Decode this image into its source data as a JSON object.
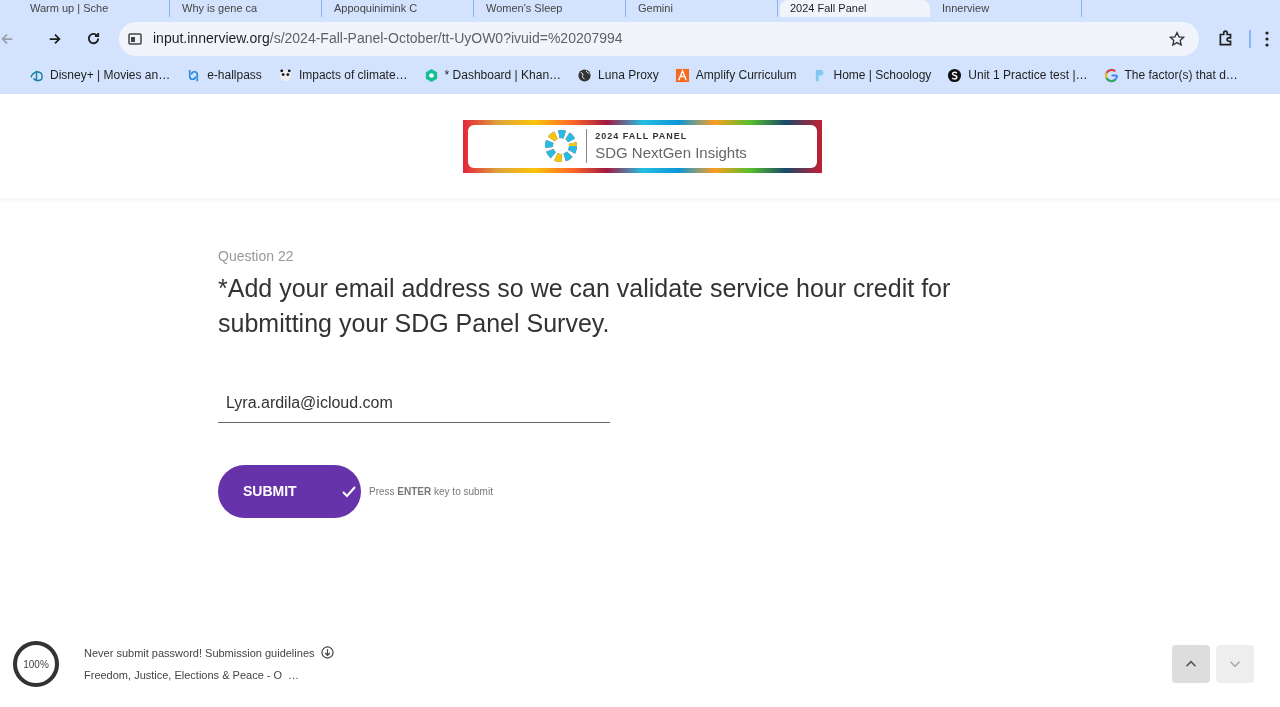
{
  "browser": {
    "tabs": [
      {
        "title": "Warm up | Sche",
        "selected": false
      },
      {
        "title": "Why is gene ca",
        "selected": false
      },
      {
        "title": "Appoquinimink C",
        "selected": false
      },
      {
        "title": "Women's Sleep",
        "selected": false
      },
      {
        "title": "Gemini",
        "selected": false
      },
      {
        "title": "2024 Fall Panel",
        "selected": true
      },
      {
        "title": "Innerview",
        "selected": false
      }
    ],
    "url": {
      "host": "input.innerview.org",
      "path": "/s/2024-Fall-Panel-October/tt-UyOW0?ivuid=%20207994"
    },
    "bookmarks": [
      {
        "label": "Disney+ | Movies an…",
        "kind": "disney"
      },
      {
        "label": "e-hallpass",
        "kind": "hallpass"
      },
      {
        "label": "Impacts of climate…",
        "kind": "panda"
      },
      {
        "label": "* Dashboard | Khan…",
        "kind": "khan"
      },
      {
        "label": "Luna Proxy",
        "kind": "globe"
      },
      {
        "label": "Amplify Curriculum",
        "kind": "amplify"
      },
      {
        "label": "Home | Schoology",
        "kind": "schoology"
      },
      {
        "label": "Unit 1 Practice test |…",
        "kind": "s"
      },
      {
        "label": "The factor(s) that d…",
        "kind": "google"
      }
    ]
  },
  "banner": {
    "kicker": "2024 FALL PANEL",
    "title": "SDG NextGen Insights"
  },
  "question": {
    "number": "Question 22",
    "text": "*Add your email address so we can validate service hour credit for submitting your SDG Panel Survey.",
    "value": "Lyra.ardila@icloud.com"
  },
  "submit": {
    "label": "SUBMIT",
    "hint": "Press **ENTER** key to submit"
  },
  "footer": {
    "progress": {
      "label": "100%",
      "level": 1
    },
    "notice": "Never submit password! Submission guidelines",
    "section": "Freedom, Justice, Elections & Peace - O",
    "more": "…",
    "nav": [
      {
        "kind": "up",
        "disabled": false
      },
      {
        "kind": "down",
        "disabled": true
      }
    ]
  }
}
